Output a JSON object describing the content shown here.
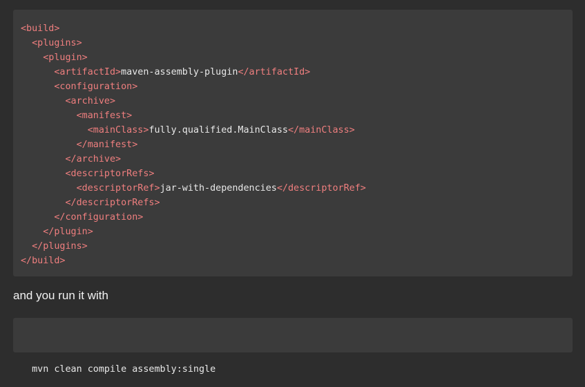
{
  "code_block": {
    "lines": [
      {
        "indent": "",
        "parts": [
          {
            "t": "tag",
            "v": "<build>"
          }
        ]
      },
      {
        "indent": "  ",
        "parts": [
          {
            "t": "tag",
            "v": "<plugins>"
          }
        ]
      },
      {
        "indent": "    ",
        "parts": [
          {
            "t": "tag",
            "v": "<plugin>"
          }
        ]
      },
      {
        "indent": "      ",
        "parts": [
          {
            "t": "tag",
            "v": "<artifactId>"
          },
          {
            "t": "txt",
            "v": "maven-assembly-plugin"
          },
          {
            "t": "tag",
            "v": "</artifactId>"
          }
        ]
      },
      {
        "indent": "      ",
        "parts": [
          {
            "t": "tag",
            "v": "<configuration>"
          }
        ]
      },
      {
        "indent": "        ",
        "parts": [
          {
            "t": "tag",
            "v": "<archive>"
          }
        ]
      },
      {
        "indent": "          ",
        "parts": [
          {
            "t": "tag",
            "v": "<manifest>"
          }
        ]
      },
      {
        "indent": "            ",
        "parts": [
          {
            "t": "tag",
            "v": "<mainClass>"
          },
          {
            "t": "txt",
            "v": "fully.qualified.MainClass"
          },
          {
            "t": "tag",
            "v": "</mainClass>"
          }
        ]
      },
      {
        "indent": "          ",
        "parts": [
          {
            "t": "tag",
            "v": "</manifest>"
          }
        ]
      },
      {
        "indent": "        ",
        "parts": [
          {
            "t": "tag",
            "v": "</archive>"
          }
        ]
      },
      {
        "indent": "        ",
        "parts": [
          {
            "t": "tag",
            "v": "<descriptorRefs>"
          }
        ]
      },
      {
        "indent": "          ",
        "parts": [
          {
            "t": "tag",
            "v": "<descriptorRef>"
          },
          {
            "t": "txt",
            "v": "jar-with-dependencies"
          },
          {
            "t": "tag",
            "v": "</descriptorRef>"
          }
        ]
      },
      {
        "indent": "        ",
        "parts": [
          {
            "t": "tag",
            "v": "</descriptorRefs>"
          }
        ]
      },
      {
        "indent": "      ",
        "parts": [
          {
            "t": "tag",
            "v": "</configuration>"
          }
        ]
      },
      {
        "indent": "    ",
        "parts": [
          {
            "t": "tag",
            "v": "</plugin>"
          }
        ]
      },
      {
        "indent": "  ",
        "parts": [
          {
            "t": "tag",
            "v": "</plugins>"
          }
        ]
      },
      {
        "indent": "",
        "parts": [
          {
            "t": "tag",
            "v": "</build>"
          }
        ]
      }
    ]
  },
  "prose_text": "and you run it with",
  "command": "mvn clean compile assembly:single",
  "colors": {
    "background": "#2d2d2d",
    "code_background": "#3b3b3b",
    "tag": "#f07f7f",
    "text": "#e8e8e8"
  }
}
